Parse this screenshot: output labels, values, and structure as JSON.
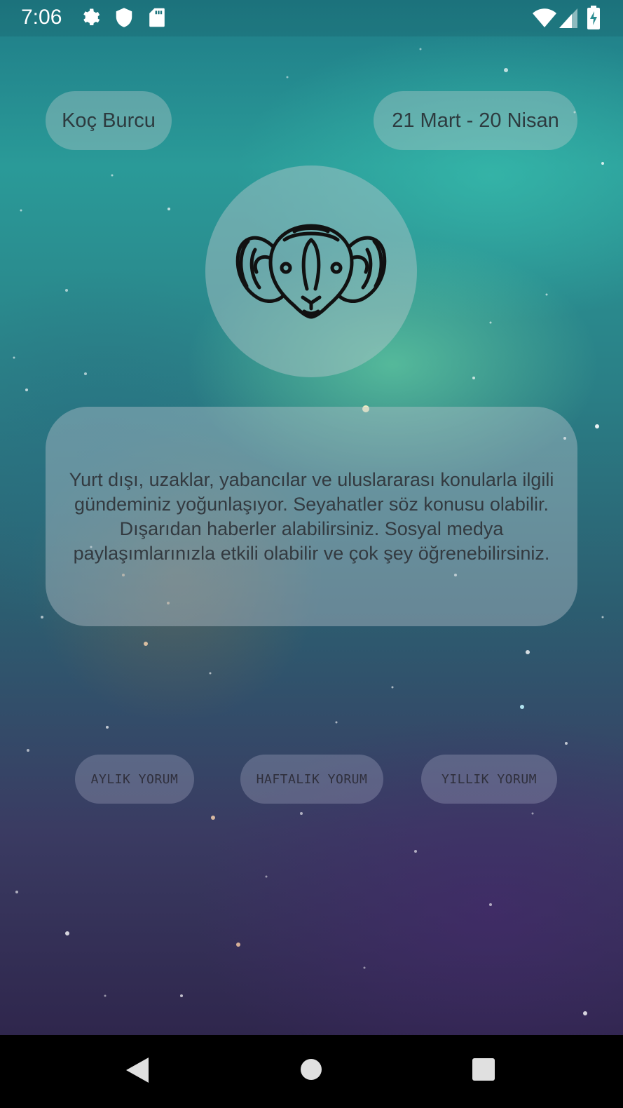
{
  "status_bar": {
    "time": "7:06",
    "icons": [
      "settings-icon",
      "shield-icon",
      "sd-card-icon",
      "wifi-icon",
      "signal-icon",
      "battery-charging-icon"
    ]
  },
  "header": {
    "sign_name": "Koç Burcu",
    "date_range": "21 Mart - 20 Nisan"
  },
  "sign_icon": "aries-ram-icon",
  "horoscope": {
    "text": "Yurt dışı, uzaklar, yabancılar ve uluslararası konularla ilgili gündeminiz yoğunlaşıyor. Seyahatler söz konusu olabilir. Dışarıdan haberler alabilirsiniz. Sosyal medya paylaşımlarınızla etkili olabilir ve çok şey öğrenebilirsiniz."
  },
  "buttons": {
    "monthly": "AYLIK YORUM",
    "weekly": "HAFTALIK YORUM",
    "yearly": "YILLIK YORUM"
  },
  "nav_bar": {
    "icons": [
      "back-icon",
      "home-icon",
      "recents-icon"
    ]
  },
  "colors": {
    "pill_text": "#2d3b3f",
    "card_text": "#333a40",
    "nav_background": "#000000"
  }
}
